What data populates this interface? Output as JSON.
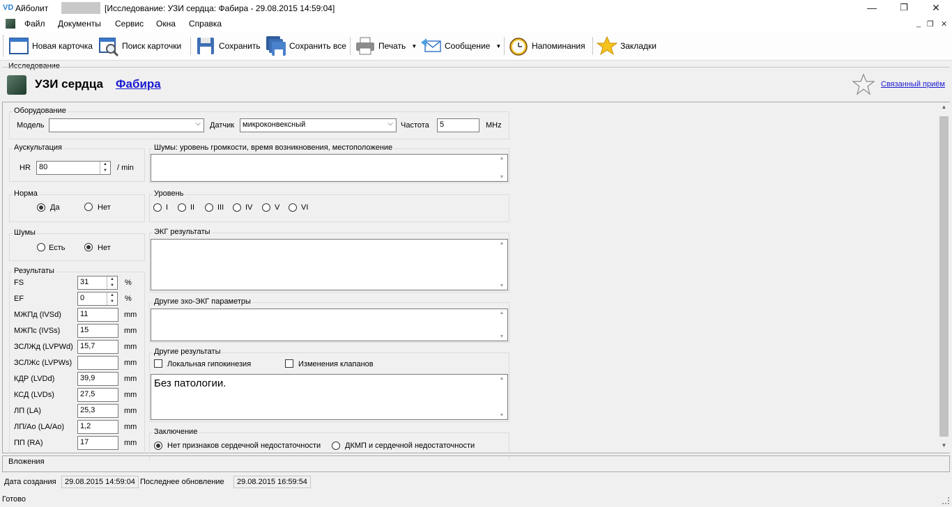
{
  "window": {
    "logo": "VD",
    "app_name": "Айболит",
    "doc_title": "[Исследование: УЗИ сердца: Фабира - 29.08.2015 14:59:04]",
    "minimize": "—",
    "maximize": "❐",
    "close": "✕"
  },
  "menu": [
    "Файл",
    "Документы",
    "Сервис",
    "Окна",
    "Справка"
  ],
  "mdi": {
    "minimize": "_",
    "restore": "❐",
    "close": "✕"
  },
  "toolbar": {
    "new_card": "Новая карточка",
    "find_card": "Поиск карточки",
    "save": "Сохранить",
    "save_all": "Сохранить все",
    "print": "Печать",
    "message": "Сообщение",
    "reminders": "Напоминания",
    "bookmarks": "Закладки"
  },
  "header": {
    "caption": "Исследование",
    "title": "УЗИ сердца",
    "patient": "Фабира",
    "linked": "Связанный приём"
  },
  "equipment": {
    "group": "Оборудование",
    "model_label": "Модель",
    "model_value": "",
    "sensor_label": "Датчик",
    "sensor_value": "микроконвексный",
    "freq_label": "Частота",
    "freq_value": "5",
    "freq_unit": "MHz"
  },
  "auscultation": {
    "group": "Аускультация",
    "hr_label": "HR",
    "hr_value": "80",
    "hr_unit": "/ min"
  },
  "noises_desc": {
    "group": "Шумы: уровень громкости, время возникновения, местоположение",
    "value": ""
  },
  "norm": {
    "group": "Норма",
    "yes": "Да",
    "no": "Нет",
    "selected": "yes"
  },
  "level": {
    "group": "Уровень",
    "options": [
      "I",
      "II",
      "III",
      "IV",
      "V",
      "VI"
    ]
  },
  "noises": {
    "group": "Шумы",
    "yes": "Есть",
    "no": "Нет",
    "selected": "no"
  },
  "ecg": {
    "group": "ЭКГ результаты",
    "value": ""
  },
  "other_echo": {
    "group": "Другие эхо-ЭКГ параметры",
    "value": ""
  },
  "results": {
    "group": "Результаты",
    "rows": [
      {
        "label": "FS",
        "value": "31",
        "unit": "%",
        "spin": true
      },
      {
        "label": "EF",
        "value": "0",
        "unit": "%",
        "spin": true
      },
      {
        "label": "МЖПд (IVSd)",
        "value": "11",
        "unit": "mm"
      },
      {
        "label": "МЖПс (IVSs)",
        "value": "15",
        "unit": "mm"
      },
      {
        "label": "ЗСЛЖд (LVPWd)",
        "value": "15,7",
        "unit": "mm"
      },
      {
        "label": "ЗСЛЖс (LVPWs)",
        "value": "",
        "unit": "mm"
      },
      {
        "label": "КДР (LVDd)",
        "value": "39,9",
        "unit": "mm"
      },
      {
        "label": "КСД (LVDs)",
        "value": "27,5",
        "unit": "mm"
      },
      {
        "label": "ЛП (LA)",
        "value": "25,3",
        "unit": "mm"
      },
      {
        "label": "ЛП/Ao (LA/Ao)",
        "value": "1,2",
        "unit": "mm"
      },
      {
        "label": "ПП (RA)",
        "value": "17",
        "unit": "mm"
      }
    ]
  },
  "other_results": {
    "group": "Другие результаты",
    "local_hypokinesis": "Локальная гипокинезия",
    "valve_changes": "Изменения клапанов",
    "text": "Без патологии."
  },
  "conclusion": {
    "group": "Заключение",
    "opt1": "Нет признаков сердечной недостаточности",
    "opt2": "ДКМП и сердечной недостаточности",
    "selected": "opt1"
  },
  "attachments": {
    "label": "Вложения"
  },
  "meta": {
    "created_label": "Дата создания",
    "created_value": "29.08.2015 14:59:04",
    "updated_label": "Последнее обновление",
    "updated_value": "29.08.2015 16:59:54"
  },
  "status": {
    "text": "Готово"
  },
  "colors": {
    "link": "#1a1ad0",
    "background": "#f0f0f0"
  }
}
